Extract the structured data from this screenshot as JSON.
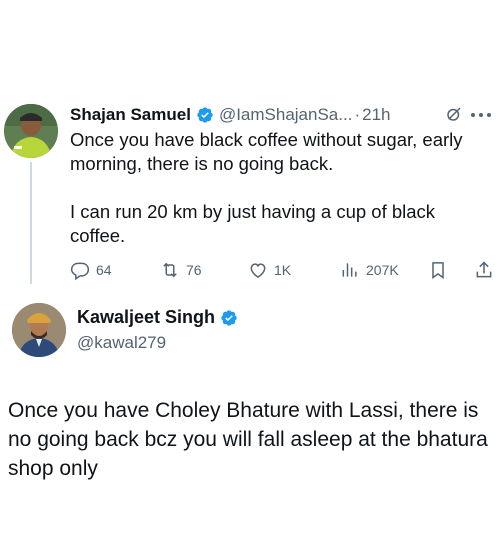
{
  "quoted_tweet": {
    "author_name": "Shajan Samuel",
    "handle": "@IamShajanSa...",
    "separator": "·",
    "time": "21h",
    "verified": true,
    "paragraphs": [
      "Once you have black coffee without sugar, early morning, there is no going back.",
      "I can run 20 km by just having a cup of black coffee."
    ],
    "metrics": {
      "replies": "64",
      "reposts": "76",
      "likes": "1K",
      "views": "207K"
    }
  },
  "reply_tweet": {
    "author_name": "Kawaljeet Singh",
    "handle": "@kawal279",
    "verified": true,
    "text": "Once you have Choley Bhature with Lassi, there is no going back bcz you will fall asleep at the bhatura shop only"
  },
  "colors": {
    "text": "#0f1419",
    "muted": "#536471",
    "verified": "#1d9bf0",
    "thread_line": "#cfd9de"
  },
  "icons": {
    "verified": "verified-badge-icon",
    "grok": "grok-icon",
    "more": "more-icon",
    "reply": "reply-icon",
    "repost": "repost-icon",
    "like": "like-icon",
    "views": "views-icon",
    "bookmark": "bookmark-icon",
    "share": "share-icon"
  }
}
